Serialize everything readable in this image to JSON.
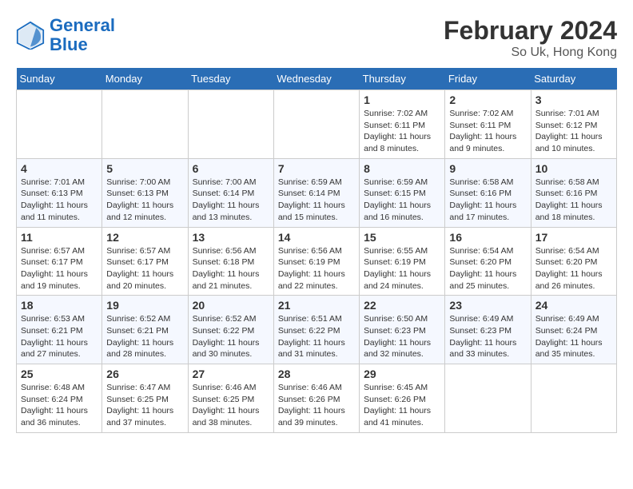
{
  "header": {
    "logo_line1": "General",
    "logo_line2": "Blue",
    "month_year": "February 2024",
    "location": "So Uk, Hong Kong"
  },
  "days_of_week": [
    "Sunday",
    "Monday",
    "Tuesday",
    "Wednesday",
    "Thursday",
    "Friday",
    "Saturday"
  ],
  "weeks": [
    [
      {
        "day": "",
        "info": ""
      },
      {
        "day": "",
        "info": ""
      },
      {
        "day": "",
        "info": ""
      },
      {
        "day": "",
        "info": ""
      },
      {
        "day": "1",
        "info": "Sunrise: 7:02 AM\nSunset: 6:11 PM\nDaylight: 11 hours and 8 minutes."
      },
      {
        "day": "2",
        "info": "Sunrise: 7:02 AM\nSunset: 6:11 PM\nDaylight: 11 hours and 9 minutes."
      },
      {
        "day": "3",
        "info": "Sunrise: 7:01 AM\nSunset: 6:12 PM\nDaylight: 11 hours and 10 minutes."
      }
    ],
    [
      {
        "day": "4",
        "info": "Sunrise: 7:01 AM\nSunset: 6:13 PM\nDaylight: 11 hours and 11 minutes."
      },
      {
        "day": "5",
        "info": "Sunrise: 7:00 AM\nSunset: 6:13 PM\nDaylight: 11 hours and 12 minutes."
      },
      {
        "day": "6",
        "info": "Sunrise: 7:00 AM\nSunset: 6:14 PM\nDaylight: 11 hours and 13 minutes."
      },
      {
        "day": "7",
        "info": "Sunrise: 6:59 AM\nSunset: 6:14 PM\nDaylight: 11 hours and 15 minutes."
      },
      {
        "day": "8",
        "info": "Sunrise: 6:59 AM\nSunset: 6:15 PM\nDaylight: 11 hours and 16 minutes."
      },
      {
        "day": "9",
        "info": "Sunrise: 6:58 AM\nSunset: 6:16 PM\nDaylight: 11 hours and 17 minutes."
      },
      {
        "day": "10",
        "info": "Sunrise: 6:58 AM\nSunset: 6:16 PM\nDaylight: 11 hours and 18 minutes."
      }
    ],
    [
      {
        "day": "11",
        "info": "Sunrise: 6:57 AM\nSunset: 6:17 PM\nDaylight: 11 hours and 19 minutes."
      },
      {
        "day": "12",
        "info": "Sunrise: 6:57 AM\nSunset: 6:17 PM\nDaylight: 11 hours and 20 minutes."
      },
      {
        "day": "13",
        "info": "Sunrise: 6:56 AM\nSunset: 6:18 PM\nDaylight: 11 hours and 21 minutes."
      },
      {
        "day": "14",
        "info": "Sunrise: 6:56 AM\nSunset: 6:19 PM\nDaylight: 11 hours and 22 minutes."
      },
      {
        "day": "15",
        "info": "Sunrise: 6:55 AM\nSunset: 6:19 PM\nDaylight: 11 hours and 24 minutes."
      },
      {
        "day": "16",
        "info": "Sunrise: 6:54 AM\nSunset: 6:20 PM\nDaylight: 11 hours and 25 minutes."
      },
      {
        "day": "17",
        "info": "Sunrise: 6:54 AM\nSunset: 6:20 PM\nDaylight: 11 hours and 26 minutes."
      }
    ],
    [
      {
        "day": "18",
        "info": "Sunrise: 6:53 AM\nSunset: 6:21 PM\nDaylight: 11 hours and 27 minutes."
      },
      {
        "day": "19",
        "info": "Sunrise: 6:52 AM\nSunset: 6:21 PM\nDaylight: 11 hours and 28 minutes."
      },
      {
        "day": "20",
        "info": "Sunrise: 6:52 AM\nSunset: 6:22 PM\nDaylight: 11 hours and 30 minutes."
      },
      {
        "day": "21",
        "info": "Sunrise: 6:51 AM\nSunset: 6:22 PM\nDaylight: 11 hours and 31 minutes."
      },
      {
        "day": "22",
        "info": "Sunrise: 6:50 AM\nSunset: 6:23 PM\nDaylight: 11 hours and 32 minutes."
      },
      {
        "day": "23",
        "info": "Sunrise: 6:49 AM\nSunset: 6:23 PM\nDaylight: 11 hours and 33 minutes."
      },
      {
        "day": "24",
        "info": "Sunrise: 6:49 AM\nSunset: 6:24 PM\nDaylight: 11 hours and 35 minutes."
      }
    ],
    [
      {
        "day": "25",
        "info": "Sunrise: 6:48 AM\nSunset: 6:24 PM\nDaylight: 11 hours and 36 minutes."
      },
      {
        "day": "26",
        "info": "Sunrise: 6:47 AM\nSunset: 6:25 PM\nDaylight: 11 hours and 37 minutes."
      },
      {
        "day": "27",
        "info": "Sunrise: 6:46 AM\nSunset: 6:25 PM\nDaylight: 11 hours and 38 minutes."
      },
      {
        "day": "28",
        "info": "Sunrise: 6:46 AM\nSunset: 6:26 PM\nDaylight: 11 hours and 39 minutes."
      },
      {
        "day": "29",
        "info": "Sunrise: 6:45 AM\nSunset: 6:26 PM\nDaylight: 11 hours and 41 minutes."
      },
      {
        "day": "",
        "info": ""
      },
      {
        "day": "",
        "info": ""
      }
    ]
  ]
}
